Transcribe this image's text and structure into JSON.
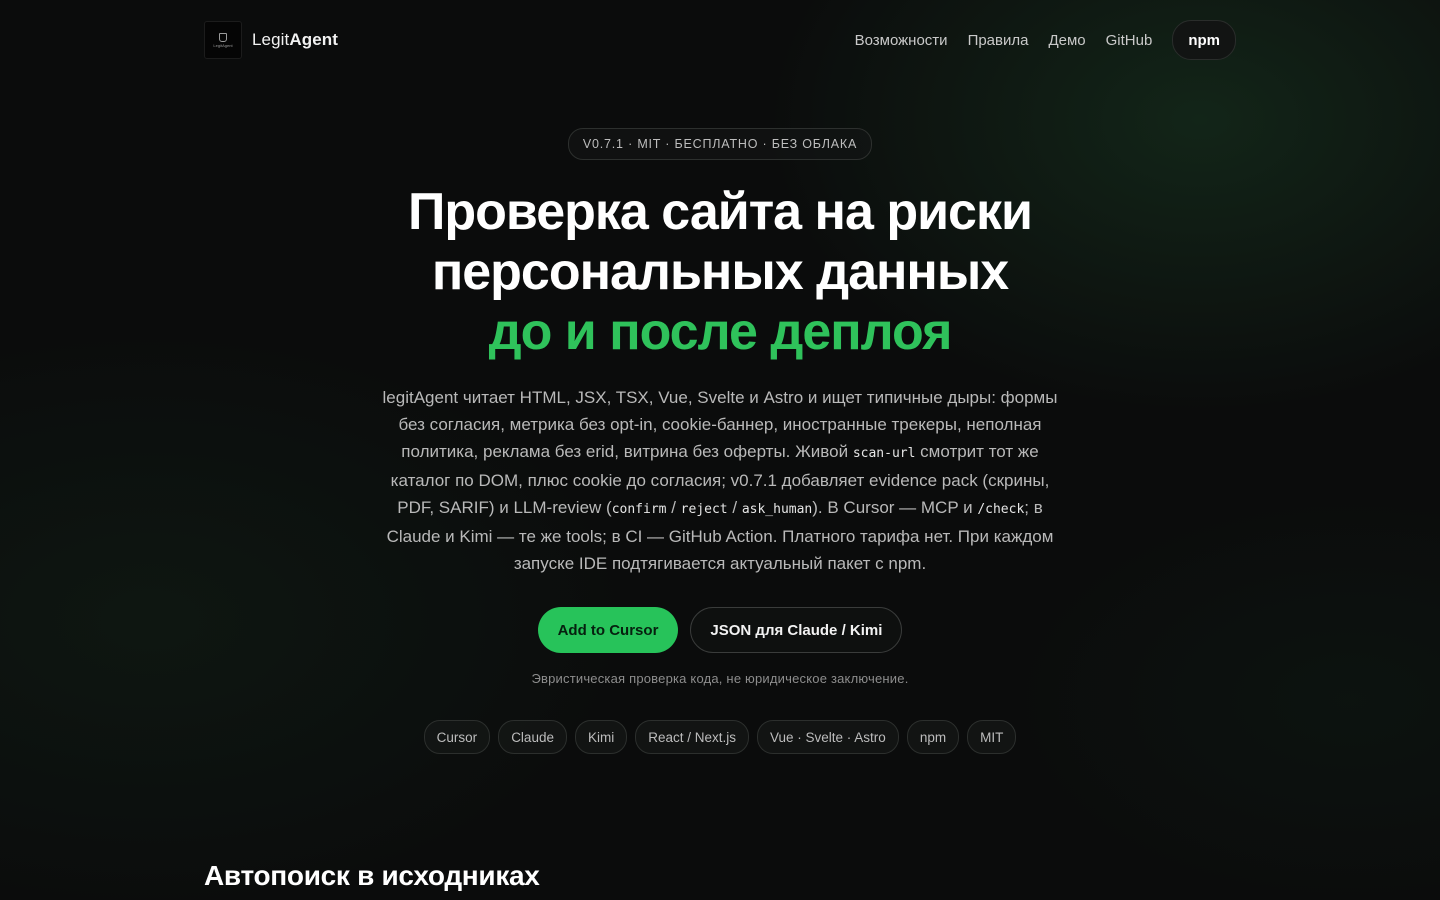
{
  "nav": {
    "brand_prefix": "Legit",
    "brand_suffix": "Agent",
    "logo_text": "LegitAgent",
    "links": [
      "Возможности",
      "Правила",
      "Демо",
      "GitHub"
    ],
    "npm_label": "npm"
  },
  "hero": {
    "badge": "V0.7.1 · MIT · БЕСПЛАТНО · БЕЗ ОБЛАКА",
    "title_line1": "Проверка сайта на риски",
    "title_line2": "персональных данных",
    "title_accent": "до и после деплоя",
    "lead": {
      "p1": "legitAgent читает HTML, JSX, TSX, Vue, Svelte и Astro и ищет типичные дыры: формы без согласия, метрика без opt-in, cookie-баннер, иностранные трекеры, неполная политика, реклама без erid, витрина без оферты. Живой ",
      "code1": "scan-url",
      "p2": " смотрит тот же каталог по DOM, плюс cookie до согласия; v0.7.1 добавляет evidence pack (скрины, PDF, SARIF) и LLM-review (",
      "code2": "confirm",
      "sep1": " / ",
      "code3": "reject",
      "sep2": " / ",
      "code4": "ask_human",
      "p3": "). В Cursor — MCP и ",
      "code5": "/check",
      "p4": "; в Claude и Kimi — те же tools; в CI — GitHub Action. Платного тарифа нет. При каждом запуске IDE подтягивается актуальный пакет с npm."
    },
    "cta_primary": "Add to Cursor",
    "cta_secondary": "JSON для Claude / Kimi",
    "disclaimer": "Эвристическая проверка кода, не юридическое заключение.",
    "tags": [
      "Cursor",
      "Claude",
      "Kimi",
      "React / Next.js",
      "Vue · Svelte · Astro",
      "npm",
      "MIT"
    ]
  },
  "section": {
    "title": "Автопоиск в исходниках"
  },
  "colors": {
    "accent": "#27c35a",
    "background": "#0b0c0c"
  }
}
